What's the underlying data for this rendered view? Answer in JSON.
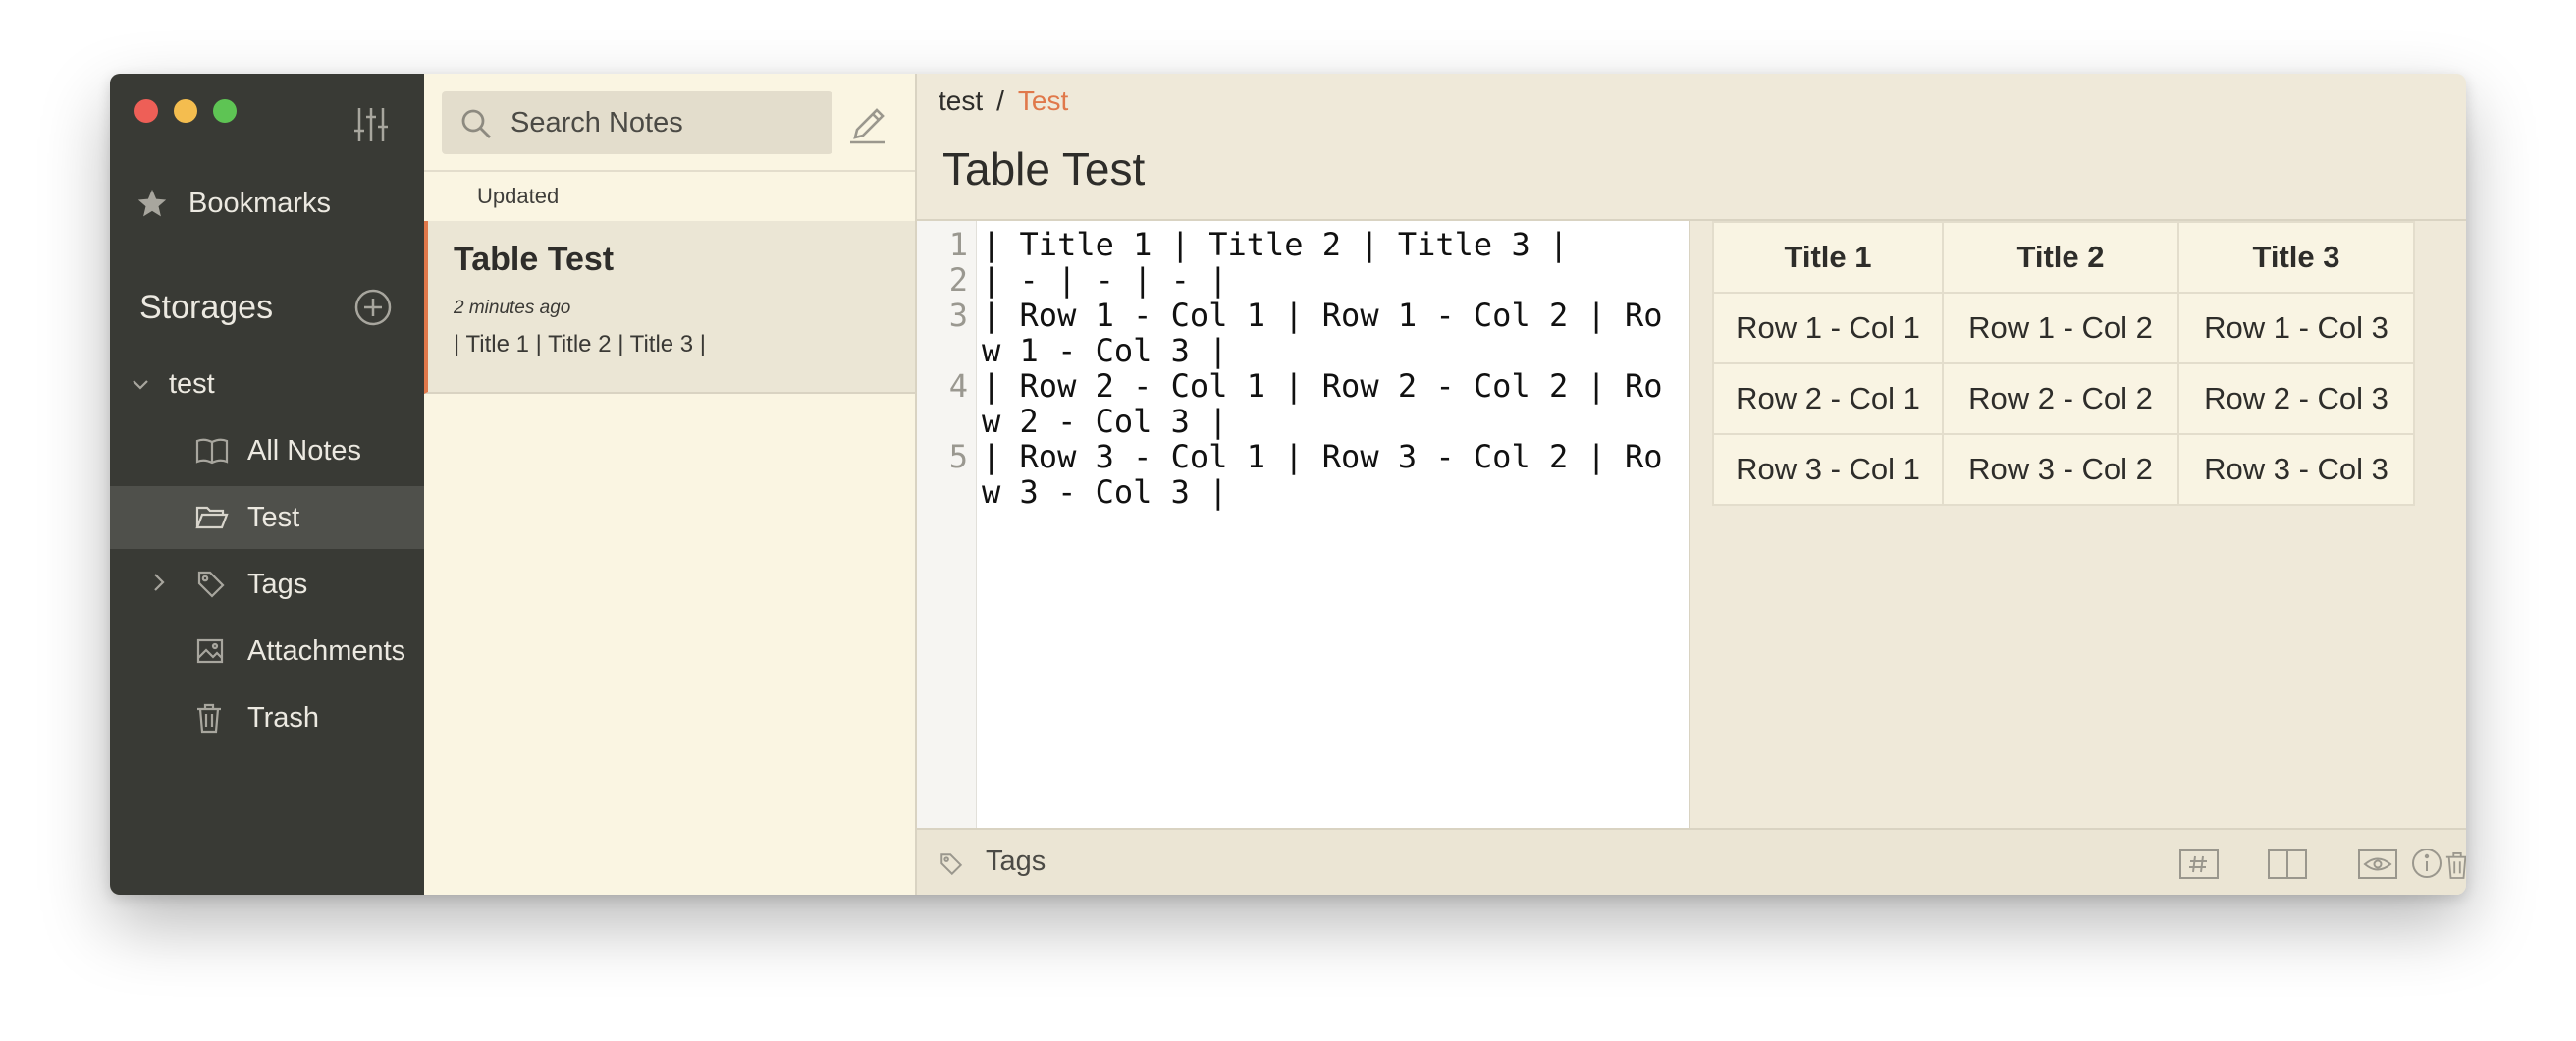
{
  "sidebar": {
    "bookmarks_label": "Bookmarks",
    "storages_label": "Storages",
    "storage_name": "test",
    "items": [
      {
        "label": "All Notes",
        "icon": "book-icon"
      },
      {
        "label": "Test",
        "icon": "folder-open-icon"
      },
      {
        "label": "Tags",
        "icon": "tag-icon"
      },
      {
        "label": "Attachments",
        "icon": "image-icon"
      },
      {
        "label": "Trash",
        "icon": "trash-icon"
      }
    ]
  },
  "notelist": {
    "search_placeholder": "Search Notes",
    "sort_label": "Updated",
    "notes": [
      {
        "title": "Table Test",
        "time": "2 minutes ago",
        "snippet": "| Title 1 | Title 2 | Title 3 |"
      }
    ]
  },
  "detail": {
    "breadcrumb": {
      "storage": "test",
      "separator": "/",
      "folder": "Test"
    },
    "title": "Table Test",
    "lines": [
      {
        "n": "1",
        "text": "| Title 1 | Title 2 | Title 3 |"
      },
      {
        "n": "2",
        "text": "| - | - | - |"
      },
      {
        "n": "3",
        "text": "| Row 1 - Col 1 | Row 1 - Col 2 | Row 1 - Col 3 |"
      },
      {
        "n": "4",
        "text": "| Row 2 - Col 1 | Row 2 - Col 2 | Row 2 - Col 3 |"
      },
      {
        "n": "5",
        "text": "| Row 3 - Col 1 | Row 3 - Col 2 | Row 3 - Col 3 |"
      }
    ],
    "table": {
      "headers": [
        "Title 1",
        "Title 2",
        "Title 3"
      ],
      "rows": [
        [
          "Row 1 - Col 1",
          "Row 1 - Col 2",
          "Row 1 - Col 3"
        ],
        [
          "Row 2 - Col 1",
          "Row 2 - Col 2",
          "Row 2 - Col 3"
        ],
        [
          "Row 3 - Col 1",
          "Row 3 - Col 2",
          "Row 3 - Col 3"
        ]
      ]
    },
    "tags_placeholder": "Tags"
  },
  "colors": {
    "accent": "#e0784a",
    "sidebar_bg": "#393a35",
    "notelist_bg": "#faf5e2",
    "detail_bg": "#efe9d9"
  }
}
